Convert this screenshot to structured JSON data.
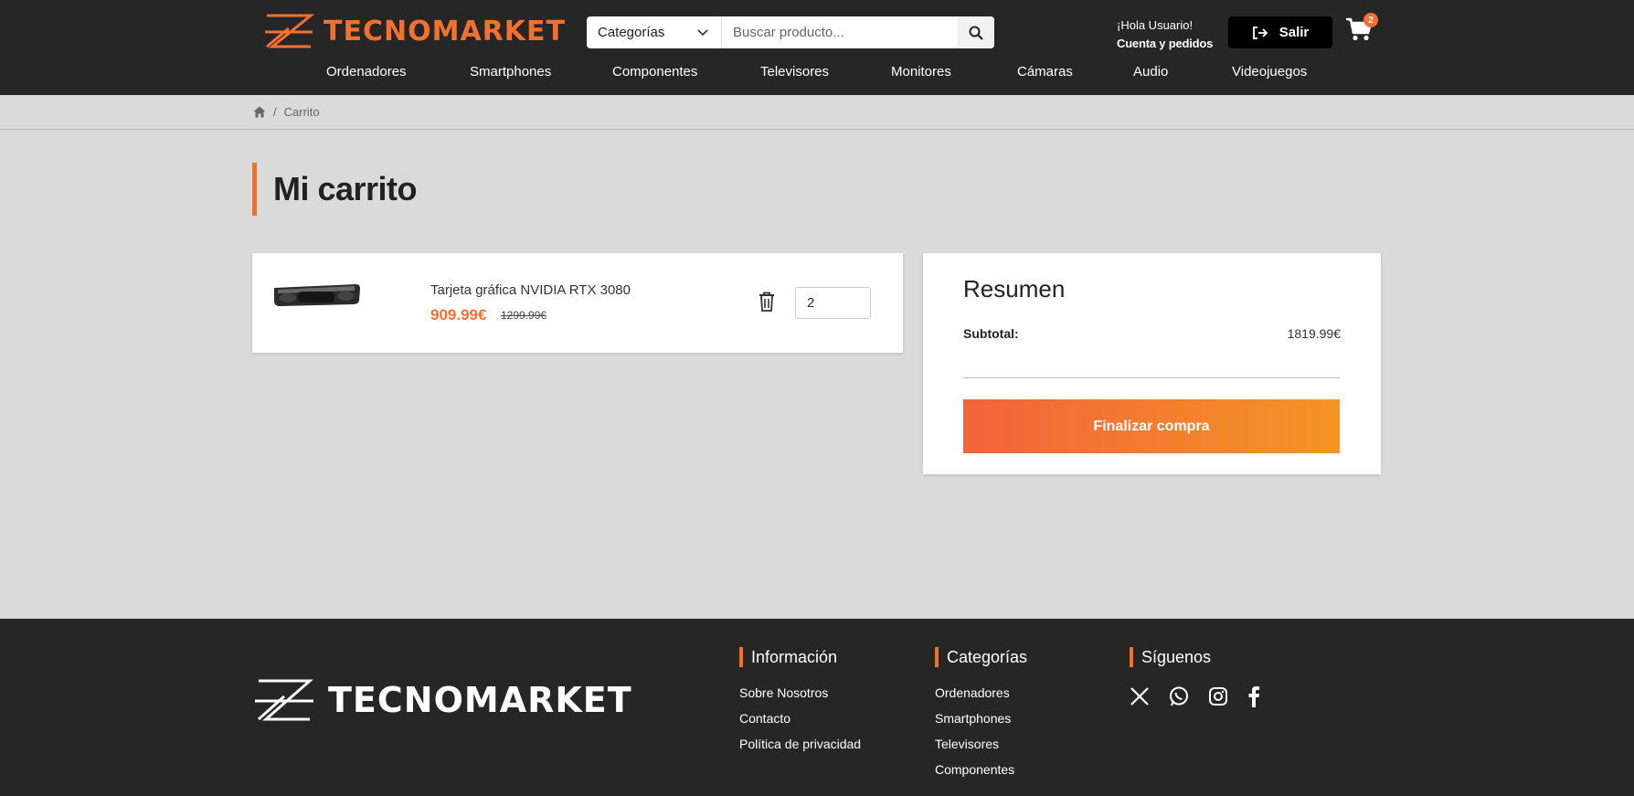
{
  "brand": {
    "name": "TECNOMARKET",
    "accent": "#f27130",
    "dark": "#262626"
  },
  "search": {
    "category_label": "Categorías",
    "placeholder": "Buscar producto..."
  },
  "user": {
    "greeting": "¡Hola Usuario!",
    "account_link": "Cuenta y pedidos",
    "logout_label": "Salir"
  },
  "cart": {
    "count": "2"
  },
  "nav": {
    "items": [
      "Ordenadores",
      "Smartphones",
      "Componentes",
      "Televisores",
      "Monitores",
      "Cámaras",
      "Audio",
      "Videojuegos"
    ]
  },
  "breadcrumb": {
    "separator": "/",
    "current": "Carrito"
  },
  "page": {
    "title": "Mi carrito"
  },
  "cart_items": [
    {
      "name": "Tarjeta gráfica NVIDIA RTX 3080",
      "price": "909.99€",
      "old_price": "1299.99€",
      "quantity": "2"
    }
  ],
  "summary": {
    "title": "Resumen",
    "subtotal_label": "Subtotal:",
    "subtotal_value": "1819.99€",
    "checkout_label": "Finalizar compra"
  },
  "footer": {
    "info": {
      "title": "Información",
      "links": [
        "Sobre Nosotros",
        "Contacto",
        "Política de privacidad"
      ]
    },
    "categories": {
      "title": "Categorías",
      "links": [
        "Ordenadores",
        "Smartphones",
        "Televisores",
        "Componentes"
      ]
    },
    "social": {
      "title": "Síguenos",
      "icons": [
        "x-icon",
        "whatsapp-icon",
        "instagram-icon",
        "facebook-icon"
      ]
    }
  }
}
